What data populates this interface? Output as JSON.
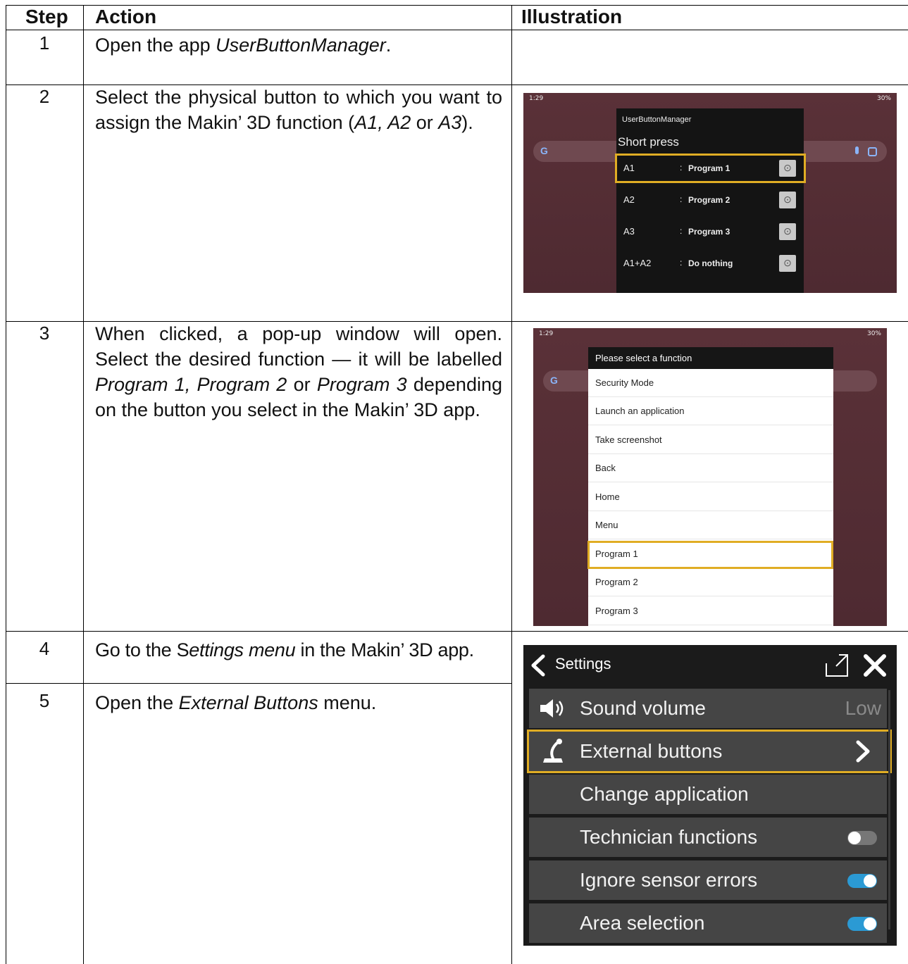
{
  "table": {
    "headers": {
      "step": "Step",
      "action": "Action",
      "illustration": "Illustration"
    },
    "rows": [
      {
        "num": "1",
        "action_parts": [
          "Open the app ",
          "UserButtonManager",
          "."
        ]
      },
      {
        "num": "2",
        "action_parts": [
          "Select the physical button to which you want to assign the Makin’ 3D function (",
          "A1, A2",
          " or ",
          "A3",
          ")."
        ]
      },
      {
        "num": "3",
        "action_parts": [
          "When clicked, a pop-up window will open. Select the desired function — it will be labelled ",
          "Program 1, Program 2",
          " or ",
          "Program 3",
          " depending on the button you select in the Makin’ 3D app."
        ]
      },
      {
        "num": "4",
        "action_parts": [
          "Go to the S",
          "ettings menu",
          " in the Makin’ 3D app."
        ]
      },
      {
        "num": "5",
        "action_parts": [
          "Open the ",
          "External Buttons",
          " menu."
        ]
      }
    ]
  },
  "shot1": {
    "status_left": "1:29",
    "status_right": "30%",
    "dialog_title": "UserButtonManager",
    "section": "Short press",
    "colon": ":",
    "rows": [
      {
        "key": "A1",
        "value": "Program 1"
      },
      {
        "key": "A2",
        "value": "Program 2"
      },
      {
        "key": "A3",
        "value": "Program 3"
      },
      {
        "key": "A1+A2",
        "value": "Do nothing"
      }
    ],
    "highlight_color": "#e0ad24"
  },
  "shot2": {
    "status_left": "1:29",
    "status_right": "30%",
    "dialog_title": "Please select a function",
    "items": [
      "Security Mode",
      "Launch an application",
      "Take screenshot",
      "Back",
      "Home",
      "Menu",
      "Program 1",
      "Program 2",
      "Program 3"
    ],
    "selected": "Program 1"
  },
  "shot3": {
    "title": "Settings",
    "rows": [
      {
        "label": "Sound volume",
        "value": "Low",
        "icon": "speaker-icon"
      },
      {
        "label": "External buttons",
        "icon": "joystick-icon",
        "chevron": true
      },
      {
        "label": "Change application"
      },
      {
        "label": "Technician functions",
        "toggle": "off"
      },
      {
        "label": "Ignore sensor errors",
        "toggle": "on"
      },
      {
        "label": "Area selection",
        "toggle": "on"
      }
    ],
    "toggle_on_color": "#2b9ad4"
  }
}
